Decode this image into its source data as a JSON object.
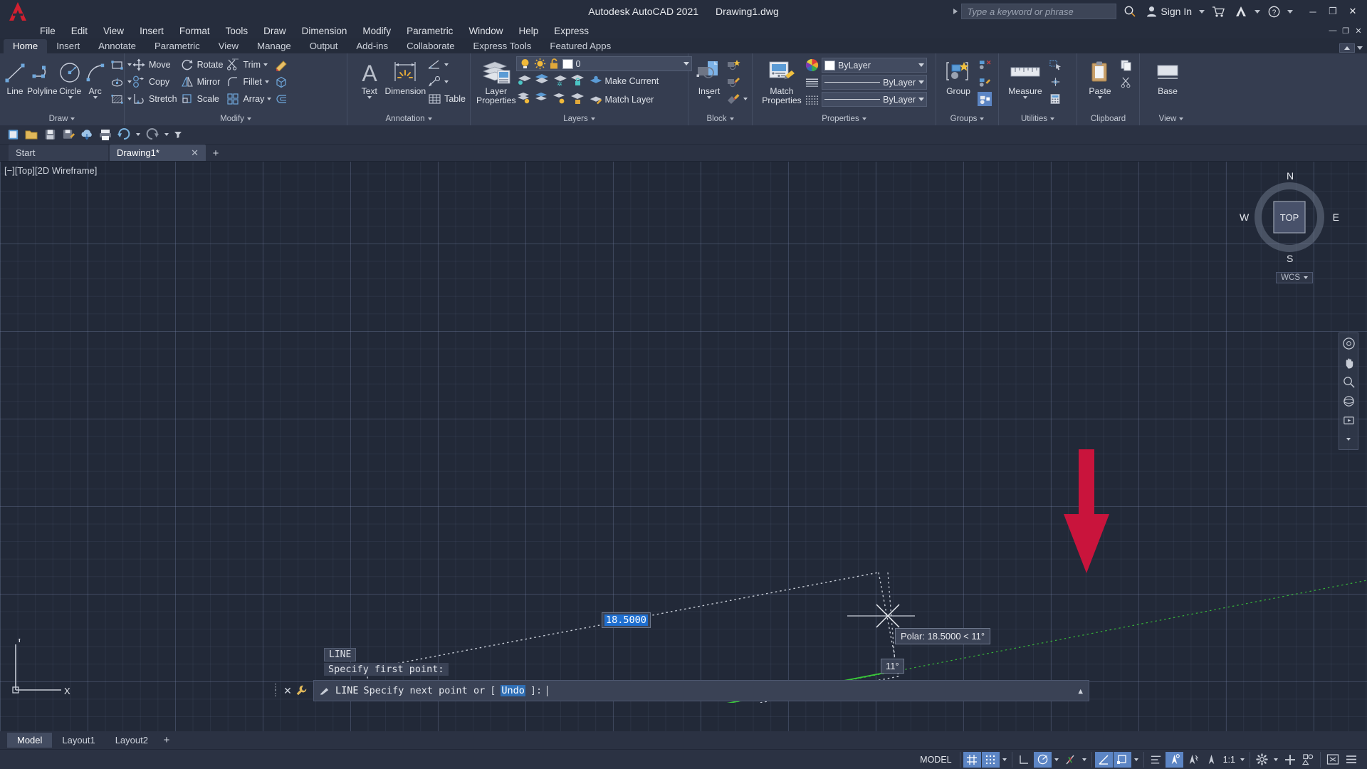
{
  "titlebar": {
    "app_title": "Autodesk AutoCAD 2021",
    "document_title": "Drawing1.dwg",
    "search_placeholder": "Type a keyword or phrase",
    "sign_in": "Sign In",
    "minimize": "─",
    "maximize": "❐",
    "close": "✕"
  },
  "menubar": {
    "items": [
      {
        "label": "File"
      },
      {
        "label": "Edit"
      },
      {
        "label": "View"
      },
      {
        "label": "Insert"
      },
      {
        "label": "Format"
      },
      {
        "label": "Tools"
      },
      {
        "label": "Draw"
      },
      {
        "label": "Dimension"
      },
      {
        "label": "Modify"
      },
      {
        "label": "Parametric"
      },
      {
        "label": "Window"
      },
      {
        "label": "Help"
      },
      {
        "label": "Express"
      }
    ],
    "restore_glyph": "❐",
    "close_glyph": "✕"
  },
  "ribbon_tabs": [
    {
      "label": "Home",
      "active": true
    },
    {
      "label": "Insert",
      "active": false
    },
    {
      "label": "Annotate",
      "active": false
    },
    {
      "label": "Parametric",
      "active": false
    },
    {
      "label": "View",
      "active": false
    },
    {
      "label": "Manage",
      "active": false
    },
    {
      "label": "Output",
      "active": false
    },
    {
      "label": "Add-ins",
      "active": false
    },
    {
      "label": "Collaborate",
      "active": false
    },
    {
      "label": "Express Tools",
      "active": false
    },
    {
      "label": "Featured Apps",
      "active": false
    }
  ],
  "ribbon": {
    "draw": {
      "title": "Draw",
      "line": "Line",
      "polyline": "Polyline",
      "circle": "Circle",
      "arc": "Arc"
    },
    "modify": {
      "title": "Modify",
      "move": "Move",
      "rotate": "Rotate",
      "trim": "Trim",
      "copy": "Copy",
      "mirror": "Mirror",
      "fillet": "Fillet",
      "stretch": "Stretch",
      "scale": "Scale",
      "array": "Array"
    },
    "annotation": {
      "title": "Annotation",
      "text": "Text",
      "dimension": "Dimension",
      "table": "Table"
    },
    "layers": {
      "title": "Layers",
      "layer_properties": "Layer\nProperties",
      "layer_properties_l1": "Layer",
      "layer_properties_l2": "Properties",
      "current_layer": "0",
      "make_current": "Make Current",
      "match_layer": "Match Layer"
    },
    "block": {
      "title": "Block",
      "insert": "Insert"
    },
    "properties": {
      "title": "Properties",
      "match_properties_l1": "Match",
      "match_properties_l2": "Properties",
      "color": "ByLayer",
      "linetype": "ByLayer",
      "lineweight": "ByLayer"
    },
    "groups": {
      "title": "Groups",
      "group": "Group"
    },
    "utilities": {
      "title": "Utilities",
      "measure": "Measure"
    },
    "clipboard": {
      "title": "Clipboard",
      "paste": "Paste"
    },
    "view": {
      "title": "View",
      "base": "Base"
    }
  },
  "filetabs": {
    "tabs": [
      {
        "label": "Start",
        "active": false,
        "closable": false
      },
      {
        "label": "Drawing1*",
        "active": true,
        "closable": true
      }
    ],
    "close_glyph": "✕",
    "add_glyph": "+"
  },
  "canvas": {
    "viewport_label": "[−][Top][2D Wireframe]",
    "viewcube": {
      "top": "TOP",
      "north": "N",
      "south": "S",
      "east": "E",
      "west": "W"
    },
    "wcs": "WCS",
    "ucs_x": "X",
    "ucs_y": "Y",
    "dynamic_input_value": "18.5000",
    "polar_tooltip": "Polar: 18.5000 < 11°",
    "angle_tooltip": "11°",
    "command_history_tag": "LINE",
    "command_history_line": "Specify first point:",
    "command_prompt_cmd": "LINE",
    "command_prompt_text": "Specify next point or",
    "command_prompt_bracket_open": "[",
    "command_prompt_option": "Undo",
    "command_prompt_bracket_close": "]:",
    "annotation_arrow_color": "#c9143c",
    "rubber_line_color": "#3ac73a"
  },
  "layouttabs": {
    "tabs": [
      {
        "label": "Model",
        "active": true
      },
      {
        "label": "Layout1",
        "active": false
      },
      {
        "label": "Layout2",
        "active": false
      }
    ],
    "add_glyph": "+"
  },
  "statusbar": {
    "model_label": "MODEL",
    "scale": "1:1",
    "buttons": [
      {
        "name": "grid-display",
        "on": true
      },
      {
        "name": "snap-mode",
        "on": true
      },
      {
        "name": "ortho-mode",
        "on": false
      },
      {
        "name": "polar-tracking",
        "on": true
      },
      {
        "name": "isometric-drafting",
        "on": false
      },
      {
        "name": "object-snap-tracking",
        "on": false
      },
      {
        "name": "object-snap",
        "on": true
      },
      {
        "name": "lineweight",
        "on": false
      },
      {
        "name": "transparency",
        "on": false
      },
      {
        "name": "annotation-visibility",
        "on": true
      },
      {
        "name": "autoscale",
        "on": false
      },
      {
        "name": "annotation-scale-icon",
        "on": false
      }
    ]
  }
}
